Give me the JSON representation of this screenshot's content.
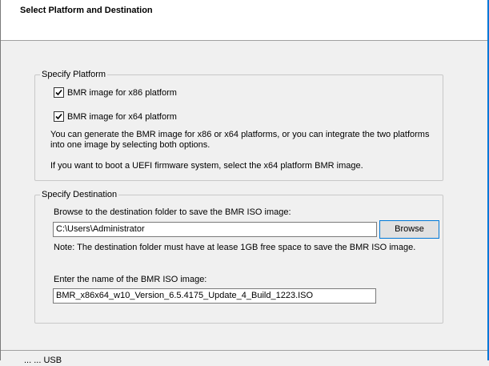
{
  "header": {
    "title": "Select Platform and Destination"
  },
  "platform": {
    "legend": "Specify Platform",
    "options": [
      {
        "label": "BMR image for x86 platform",
        "checked": true
      },
      {
        "label": "BMR image for x64 platform",
        "checked": true
      }
    ],
    "info_line1": "You can generate the BMR image for x86 or x64 platforms, or you can integrate the two platforms",
    "info_line2": "into one image by selecting both options.",
    "uefi_note": "If you want to boot a UEFI firmware system, select the x64 platform BMR image."
  },
  "destination": {
    "legend": "Specify Destination",
    "browse_label": "Browse to the destination folder to save the BMR ISO image:",
    "folder_value": "C:\\Users\\Administrator",
    "browse_button": "Browse",
    "space_note": "Note: The destination folder must have at lease 1GB free space to save the BMR ISO image.",
    "iso_name_label": "Enter the name of the BMR ISO image:",
    "iso_name_value": "BMR_x86x64_w10_Version_6.5.4175_Update_4_Build_1223.ISO"
  },
  "footer": {
    "partial_text": "... ... USB"
  }
}
